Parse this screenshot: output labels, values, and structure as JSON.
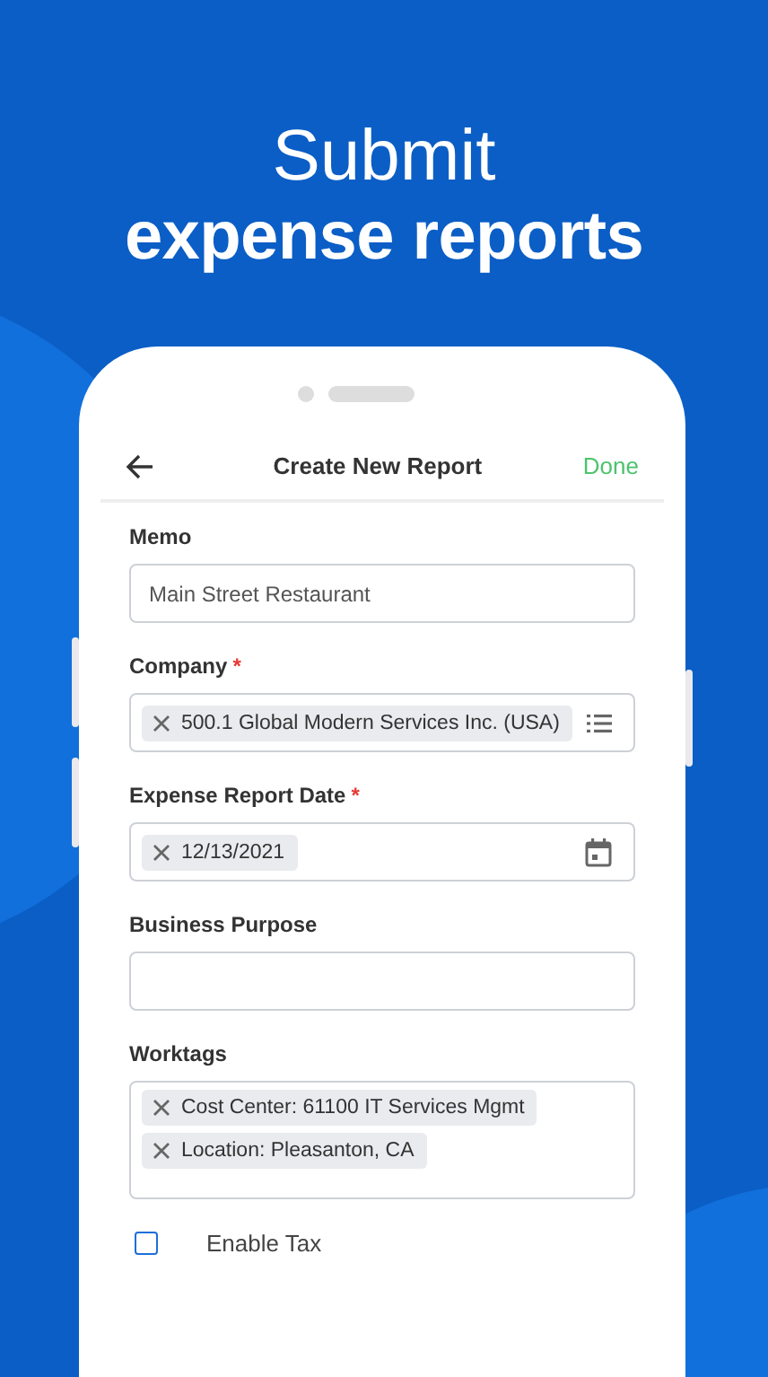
{
  "headline": {
    "line_1": "Submit",
    "line_2": "expense reports"
  },
  "header": {
    "title": "Create New Report",
    "action": "Done"
  },
  "fields": [
    {
      "label": "Memo",
      "kind": "text",
      "value": "Main Street Restaurant"
    },
    {
      "label": "Company",
      "required_mark": "*",
      "kind": "select",
      "chips": [
        "500.1 Global Modern Services Inc. (USA)"
      ]
    },
    {
      "label": "Expense Report Date",
      "required_mark": "*",
      "kind": "date",
      "chips": [
        "12/13/2021"
      ]
    },
    {
      "label": "Business Purpose",
      "kind": "text"
    },
    {
      "label": "Worktags",
      "kind": "tags",
      "chips": [
        "Cost Center: 61100 IT Services Mgmt",
        "Location: Pleasanton, CA"
      ]
    }
  ],
  "checkbox": {
    "label": "Enable Tax",
    "checked": false
  }
}
